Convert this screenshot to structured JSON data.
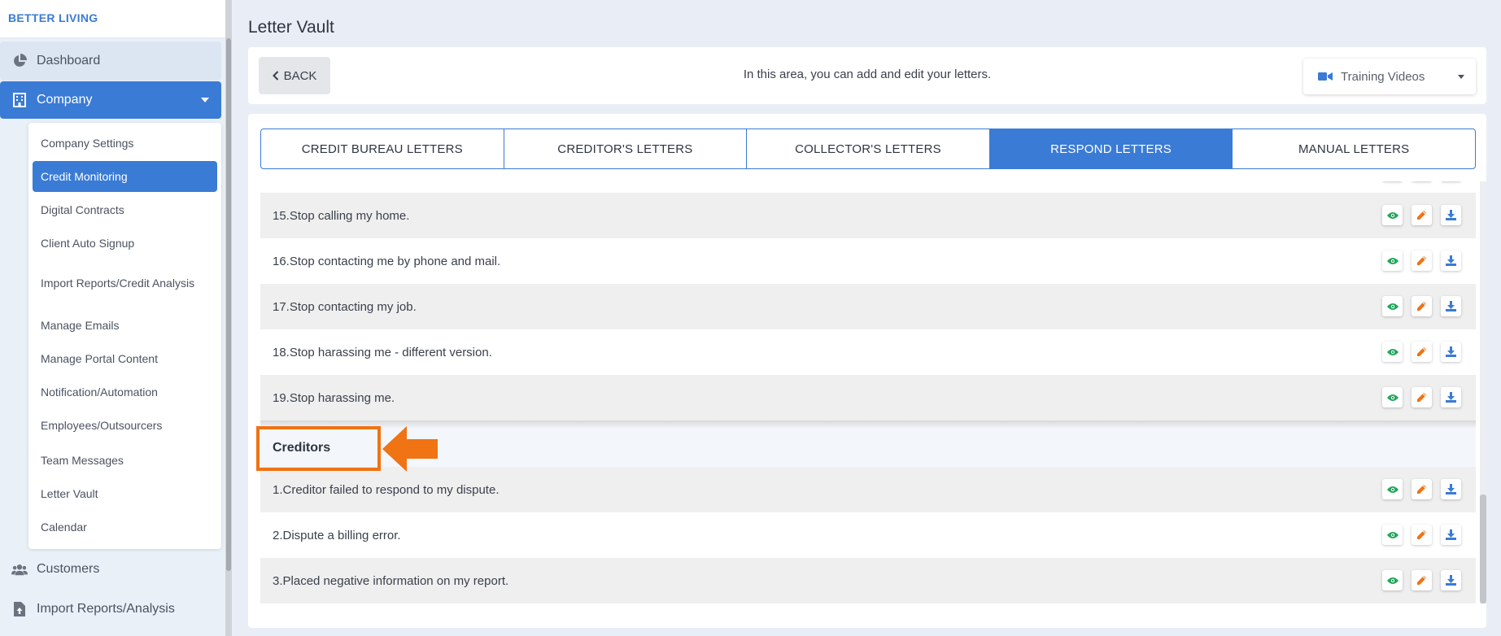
{
  "brand": "BETTER LIVING",
  "sidebar": {
    "dashboard": "Dashboard",
    "company": "Company",
    "submenu": [
      "Company Settings",
      "Credit Monitoring",
      "Digital Contracts",
      "Client Auto Signup",
      "Import Reports/Credit Analysis",
      "Manage Emails",
      "Manage Portal Content",
      "Notification/Automation",
      "Employees/Outsourcers",
      "Team Messages",
      "Letter Vault",
      "Calendar"
    ],
    "customers": "Customers",
    "import": "Import Reports/Analysis"
  },
  "page": {
    "title": "Letter Vault",
    "back": "BACK",
    "info": "In this area, you can add and edit your letters.",
    "training": "Training Videos"
  },
  "tabs": [
    "CREDIT BUREAU LETTERS",
    "CREDITOR'S LETTERS",
    "COLLECTOR'S LETTERS",
    "RESPOND LETTERS",
    "MANUAL LETTERS"
  ],
  "letters": [
    "15.Stop calling my home.",
    "16.Stop contacting me by phone and mail.",
    "17.Stop contacting my job.",
    "18.Stop harassing me - different version.",
    "19.Stop harassing me."
  ],
  "section": "Creditors",
  "creditor_letters": [
    "1.Creditor failed to respond to my dispute.",
    "2.Dispute a billing error.",
    "3.Placed negative information on my report."
  ],
  "colors": {
    "primary": "#3a7bd5",
    "view": "#22a55a",
    "edit": "#f07314",
    "download": "#3a7bd5",
    "highlight": "#f07314"
  }
}
